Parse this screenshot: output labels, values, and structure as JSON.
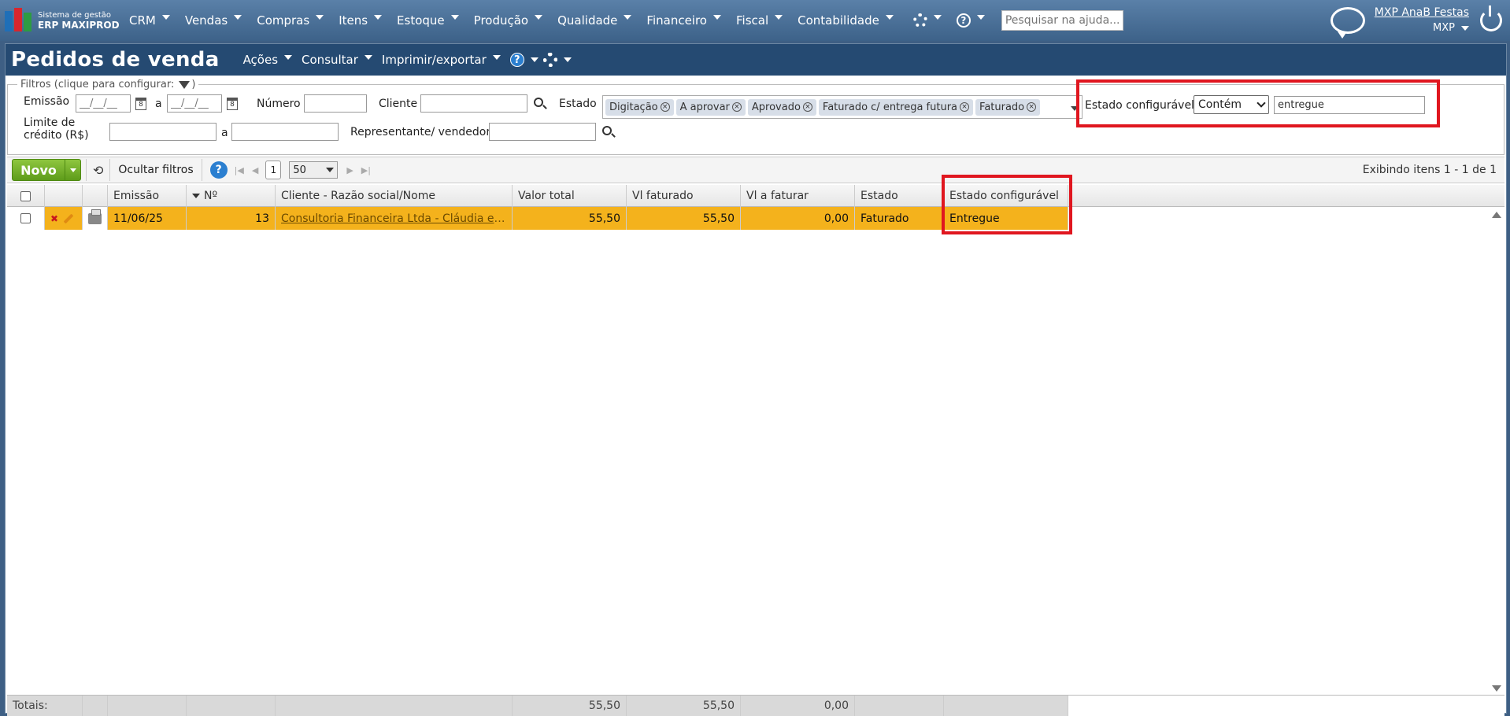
{
  "app": {
    "logo_line1": "Sistema de gestão",
    "logo_line2": "ERP MAXIPROD",
    "menu": [
      "CRM",
      "Vendas",
      "Compras",
      "Itens",
      "Estoque",
      "Produção",
      "Qualidade",
      "Financeiro",
      "Fiscal",
      "Contabilidade"
    ],
    "help_search_placeholder": "Pesquisar na ajuda...",
    "user_name": "MXP AnaB Festas",
    "company": "MXP"
  },
  "page": {
    "title": "Pedidos de venda",
    "menus": [
      "Ações",
      "Consultar",
      "Imprimir/exportar"
    ],
    "help_label": "?"
  },
  "filters": {
    "legend": "Filtros (clique para configurar:",
    "legend_end": ")",
    "emissao_label": "Emissão",
    "date_placeholder": "__/__/__",
    "date_sep": "a",
    "cal_glyph": "8",
    "numero_label": "Número",
    "cliente_label": "Cliente",
    "estado_label": "Estado",
    "estado_chips": [
      "Digitação",
      "A aprovar",
      "Aprovado",
      "Faturado c/ entrega futura",
      "Faturado"
    ],
    "estado_config_label": "Estado configurável",
    "estado_config_operator": "Contém",
    "estado_config_value": "entregue",
    "limite_label_1": "Limite de",
    "limite_label_2": "crédito (R$)",
    "limite_sep": "a",
    "representante_label": "Representante/ vendedor"
  },
  "toolbar": {
    "novo_label": "Novo",
    "hide_filters_label": "Ocultar filtros",
    "help_label": "?",
    "page": "1",
    "page_size": "50",
    "exibindo": "Exibindo itens 1 - 1 de 1"
  },
  "grid": {
    "columns": [
      "Emissão",
      "Nº",
      "Cliente - Razão social/Nome",
      "Valor total",
      "Vl faturado",
      "Vl a faturar",
      "Estado",
      "Estado configurável"
    ],
    "rows": [
      {
        "emissao": "11/06/25",
        "numero": "13",
        "cliente": "Consultoria Financeira Ltda - Cláudia e ...",
        "valor_total": "55,50",
        "vl_faturado": "55,50",
        "vl_a_faturar": "0,00",
        "estado": "Faturado",
        "estado_configuravel": "Entregue"
      }
    ],
    "totals_label": "Totais:",
    "totals": {
      "valor_total": "55,50",
      "vl_faturado": "55,50",
      "vl_a_faturar": "0,00"
    }
  },
  "colors": {
    "highlight_row": "#f4b21c",
    "annotation_red": "#e0161f",
    "title_bar": "#254a72"
  }
}
